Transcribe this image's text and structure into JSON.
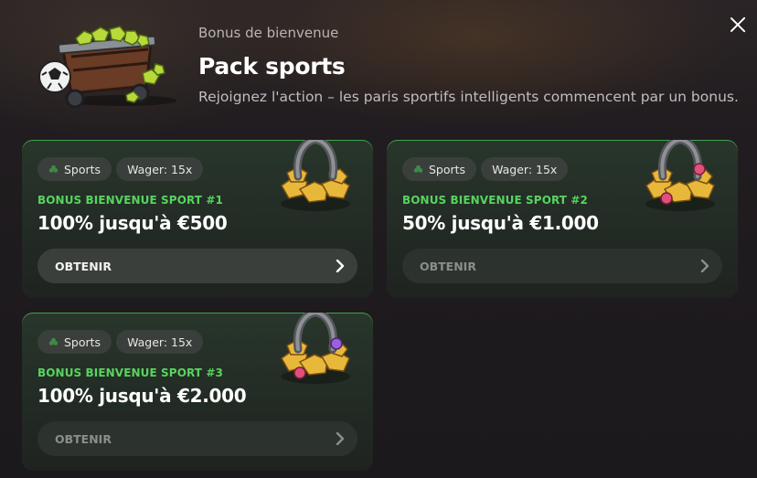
{
  "header": {
    "eyebrow": "Bonus de bienvenue",
    "title": "Pack sports",
    "subtitle": "Rejoignez l'action – les paris sportifs intelligents commencent par un bonus."
  },
  "close_icon": "close-icon",
  "cards": [
    {
      "tag_sport": "Sports",
      "tag_wager": "Wager: 15x",
      "label": "BONUS BIENVENUE SPORT #1",
      "amount": "100% jusqu'à €500",
      "button": "OBTENIR",
      "button_state": "active",
      "gem_color": "#f0c64b"
    },
    {
      "tag_sport": "Sports",
      "tag_wager": "Wager: 15x",
      "label": "BONUS BIENVENUE SPORT #2",
      "amount": "50% jusqu'à €1.000",
      "button": "OBTENIR",
      "button_state": "disabled",
      "gem_color": "#e0507a"
    },
    {
      "tag_sport": "Sports",
      "tag_wager": "Wager: 15x",
      "label": "BONUS BIENVENUE SPORT #3",
      "amount": "100% jusqu'à €2.000",
      "button": "OBTENIR",
      "button_state": "disabled",
      "gem_color": "#9a5fe0"
    }
  ],
  "colors": {
    "accent_green": "#57d45f",
    "card_border": "#3fa34d",
    "tag_bg": "#3a3f3b"
  }
}
